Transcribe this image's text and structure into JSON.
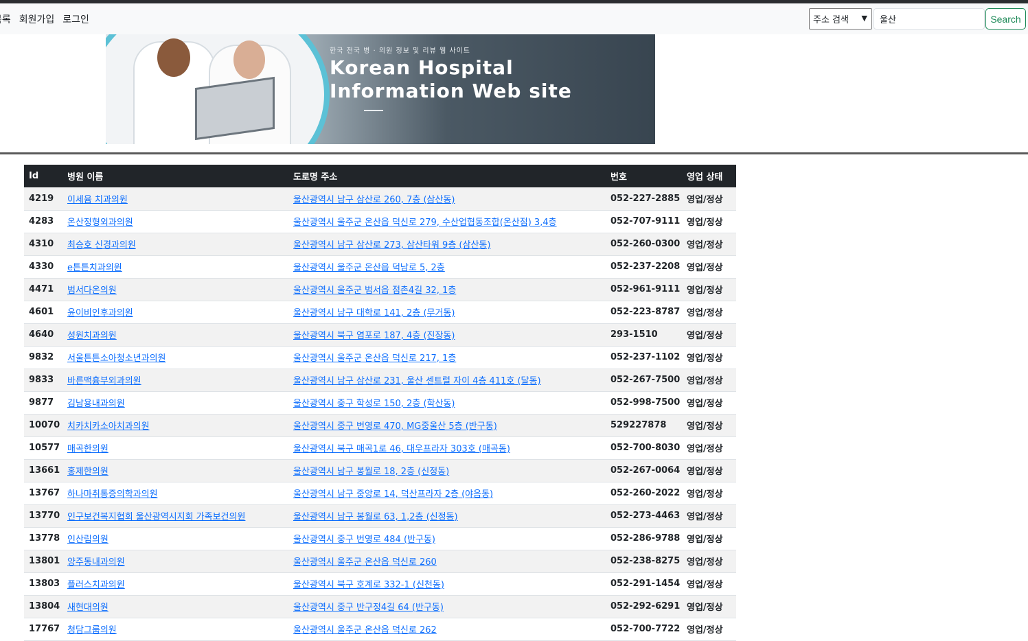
{
  "nav": {
    "links": [
      "목록",
      "회원가입",
      "로그인"
    ]
  },
  "search": {
    "select_value": "주소 검색",
    "input_value": "울산",
    "button_label": "Search",
    "button_color": "#198754"
  },
  "banner": {
    "subtitle": "한국 전국 병 · 의원 정보 및 리뷰 웹 사이트",
    "title_line1": "Korean Hospital",
    "title_line2": "Information Web site"
  },
  "table": {
    "headers": [
      "Id",
      "병원 이름",
      "도로명 주소",
      "번호",
      "영업 상태"
    ],
    "rows": [
      {
        "id": "4219",
        "name": "이세윰 치과의원",
        "address": "울산광역시 남구 삼산로 260, 7층 (삼산동)",
        "phone": "052-227-2885",
        "status": "영업/정상"
      },
      {
        "id": "4283",
        "name": "온산정형외과의원",
        "address": "울산광역시 울주군 온산읍 덕신로 279, 수산업협동조합(온산점) 3,4층",
        "phone": "052-707-9111",
        "status": "영업/정상"
      },
      {
        "id": "4310",
        "name": "최승호 신경과의원",
        "address": "울산광역시 남구 삼산로 273, 삼산타워 9층 (삼산동)",
        "phone": "052-260-0300",
        "status": "영업/정상"
      },
      {
        "id": "4330",
        "name": "e튼튼치과의원",
        "address": "울산광역시 울주군 온산읍 덕남로 5, 2층",
        "phone": "052-237-2208",
        "status": "영업/정상"
      },
      {
        "id": "4471",
        "name": "범서다온의원",
        "address": "울산광역시 울주군 범서읍 점촌4길 32, 1층",
        "phone": "052-961-9111",
        "status": "영업/정상"
      },
      {
        "id": "4601",
        "name": "윤이비인후과의원",
        "address": "울산광역시 남구 대학로 141, 2층 (무거동)",
        "phone": "052-223-8787",
        "status": "영업/정상"
      },
      {
        "id": "4640",
        "name": "성원치과의원",
        "address": "울산광역시 북구 염포로 187, 4층 (진장동)",
        "phone": "293-1510",
        "status": "영업/정상"
      },
      {
        "id": "9832",
        "name": "서울튼튼소아청소년과의원",
        "address": "울산광역시 울주군 온산읍 덕신로 217, 1층",
        "phone": "052-237-1102",
        "status": "영업/정상"
      },
      {
        "id": "9833",
        "name": "바른맥흉부외과의원",
        "address": "울산광역시 남구 삼산로 231, 울산 센트럴 자이 4층 411호 (달동)",
        "phone": "052-267-7500",
        "status": "영업/정상"
      },
      {
        "id": "9877",
        "name": "김남용내과의원",
        "address": "울산광역시 중구 학성로 150, 2층 (학산동)",
        "phone": "052-998-7500",
        "status": "영업/정상"
      },
      {
        "id": "10070",
        "name": "치카치카소아치과의원",
        "address": "울산광역시 중구 번영로 470, MG중울산 5층 (반구동)",
        "phone": "529227878",
        "status": "영업/정상"
      },
      {
        "id": "10577",
        "name": "매곡한의원",
        "address": "울산광역시 북구 매곡1로 46, 대우프라자 303호 (매곡동)",
        "phone": "052-700-8030",
        "status": "영업/정상"
      },
      {
        "id": "13661",
        "name": "홍제한의원",
        "address": "울산광역시 남구 봉월로 18, 2층 (신정동)",
        "phone": "052-267-0064",
        "status": "영업/정상"
      },
      {
        "id": "13767",
        "name": "하나마취통증의학과의원",
        "address": "울산광역시 남구 중앙로 14, 덕산프라자 2층 (야음동)",
        "phone": "052-260-2022",
        "status": "영업/정상"
      },
      {
        "id": "13770",
        "name": "인구보건복지협회 울산광역시지회 가족보건의원",
        "address": "울산광역시 남구 봉월로 63, 1,2층 (신정동)",
        "phone": "052-273-4463",
        "status": "영업/정상"
      },
      {
        "id": "13778",
        "name": "인산림의원",
        "address": "울산광역시 중구 번영로 484 (반구동)",
        "phone": "052-286-9788",
        "status": "영업/정상"
      },
      {
        "id": "13801",
        "name": "양주동내과의원",
        "address": "울산광역시 울주군 온산읍 덕신로 260",
        "phone": "052-238-8275",
        "status": "영업/정상"
      },
      {
        "id": "13803",
        "name": "플러스치과의원",
        "address": "울산광역시 북구 호계로 332-1 (신천동)",
        "phone": "052-291-1454",
        "status": "영업/정상"
      },
      {
        "id": "13804",
        "name": "새현대의원",
        "address": "울산광역시 중구 반구정4길 64 (반구동)",
        "phone": "052-292-6291",
        "status": "영업/정상"
      },
      {
        "id": "17767",
        "name": "청담그룹의원",
        "address": "울산광역시 울주군 온산읍 덕신로 262",
        "phone": "052-700-7722",
        "status": "영업/정상"
      }
    ]
  }
}
